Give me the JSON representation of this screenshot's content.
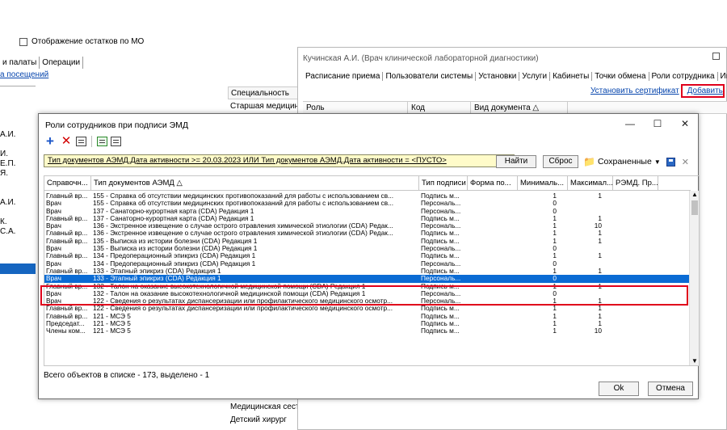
{
  "background": {
    "checkbox_label": "Отображение остатков по МО",
    "tabs": [
      "и палаты",
      "Операции"
    ],
    "visits_link": "а посещений",
    "left_items": [
      "",
      "А.И.",
      "",
      "И.",
      "Е.П.",
      "Я.",
      "",
      "",
      "А.И.",
      "",
      "К.",
      "С.А."
    ],
    "spec_header": "Специальность",
    "spec_top": "Старшая медицинс",
    "spec_bottom": [
      "Медицинская сестр",
      "Детский хирург"
    ]
  },
  "win2": {
    "title": "Кучинская А.И. (Врач клинической лабораторной диагностики)",
    "tabs": [
      "Расписание приема",
      "Пользователи системы",
      "Установки",
      "Услуги",
      "Кабинеты",
      "Точки обмена",
      "Роли сотрудника",
      "Инд"
    ],
    "link_cert": "Установить сертификат",
    "link_add": "Добавить",
    "grid_cols": [
      "Роль",
      "Код",
      "Вид документа"
    ]
  },
  "dialog": {
    "title": "Роли сотрудников при подписи ЭМД",
    "ctrl_min": "—",
    "ctrl_max": "☐",
    "ctrl_close": "✕",
    "toolbar_add": "+",
    "toolbar_delete": "✕",
    "filter_text": "Тип документов АЭМД.Дата активности >= 20.03.2023 ИЛИ Тип документов АЭМД.Дата активности = <ПУСТО>",
    "find_label": "Найти",
    "reset_label": "Сброс",
    "saved_label": "Сохраненные",
    "columns": [
      "Справочн...",
      "Тип документов АЭМД",
      "Тип подписи",
      "Форма по...",
      "Минималь...",
      "Максимал...",
      "РЭМД. Пр..."
    ],
    "rows": [
      [
        "Главный вр...",
        "155 - Справка об отсутствии медицинских противопоказаний для работы с использованием св...",
        "Подпись м...",
        "",
        "1",
        "1",
        ""
      ],
      [
        "Врач",
        "155 - Справка об отсутствии медицинских противопоказаний для работы с использованием св...",
        "Персональ...",
        "",
        "0",
        "",
        ""
      ],
      [
        "Врач",
        "137 - Санаторно-курортная карта (CDA) Редакция 1",
        "Персональ...",
        "",
        "0",
        "",
        ""
      ],
      [
        "Главный вр...",
        "137 - Санаторно-курортная карта (CDA) Редакция 1",
        "Подпись м...",
        "",
        "1",
        "1",
        ""
      ],
      [
        "Врач",
        "136 - Экстренное извещение о случае острого отравления химической этиологии (CDA) Редак...",
        "Персональ...",
        "",
        "1",
        "10",
        ""
      ],
      [
        "Главный вр...",
        "136 - Экстренное извещение о случае острого отравления химической этиологии (CDA) Редак...",
        "Подпись м...",
        "",
        "1",
        "1",
        ""
      ],
      [
        "Главный вр...",
        "135 - Выписка из истории болезни (CDA) Редакция 1",
        "Подпись м...",
        "",
        "1",
        "1",
        ""
      ],
      [
        "Врач",
        "135 - Выписка из истории болезни (CDA) Редакция 1",
        "Персональ...",
        "",
        "0",
        "",
        ""
      ],
      [
        "Главный вр...",
        "134 - Предоперационный эпикриз (CDA) Редакция 1",
        "Подпись м...",
        "",
        "1",
        "1",
        ""
      ],
      [
        "Врач",
        "134 - Предоперационный эпикриз (CDA) Редакция 1",
        "Персональ...",
        "",
        "0",
        "",
        ""
      ],
      [
        "Главный вр...",
        "133 - Этапный эпикриз (CDA) Редакция 1",
        "Подпись м...",
        "",
        "1",
        "1",
        ""
      ],
      [
        "Врач",
        "133 - Этапный эпикриз (CDA) Редакция 1",
        "Персональ...",
        "",
        "0",
        "",
        ""
      ],
      [
        "Главный вр...",
        "132 - Талон на оказание высокотехнологичной медицинской помощи (CDA) Редакция 1",
        "Подпись м...",
        "",
        "1",
        "1",
        ""
      ],
      [
        "Врач",
        "132 - Талон на оказание высокотехнологичной медицинской помощи (CDA) Редакция 1",
        "Персональ...",
        "",
        "0",
        "",
        ""
      ],
      [
        "Врач",
        "122 - Сведения о результатах диспансеризации или профилактического медицинского осмотр...",
        "Персональ...",
        "",
        "1",
        "1",
        ""
      ],
      [
        "Главный вр...",
        "122 - Сведения о результатах диспансеризации или профилактического медицинского осмотр...",
        "Подпись м...",
        "",
        "1",
        "1",
        ""
      ],
      [
        "Главный вр...",
        "121 - МСЭ 5",
        "Подпись м...",
        "",
        "1",
        "1",
        ""
      ],
      [
        "Председат...",
        "121 - МСЭ 5",
        "Подпись м...",
        "",
        "1",
        "1",
        ""
      ],
      [
        "Члены ком...",
        "121 - МСЭ 5",
        "Подпись м...",
        "",
        "1",
        "10",
        ""
      ]
    ],
    "selected_row_index": 11,
    "status": "Всего объектов в списке - 173, выделено - 1",
    "ok_label": "Ok",
    "cancel_label": "Отмена"
  },
  "colors": {
    "selection": "#0a6bd4",
    "highlight": "#e0001b",
    "filter_bg": "#fffbc9",
    "link": "#0645ad"
  }
}
